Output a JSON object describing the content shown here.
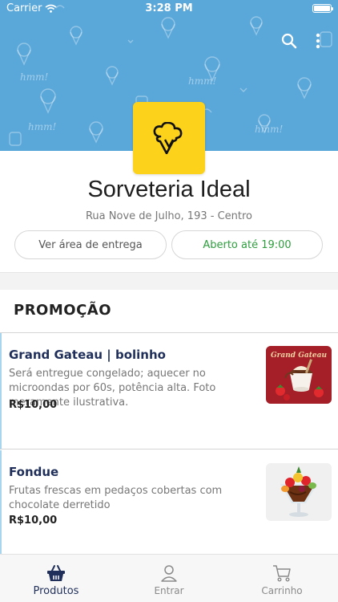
{
  "status_bar": {
    "carrier": "Carrier",
    "time": "3:28 PM"
  },
  "store": {
    "name": "Sorveteria Ideal",
    "address": "Rua Nove de Julho, 193 - Centro",
    "delivery_area_label": "Ver área de entrega",
    "hours_label": "Aberto até 19:00"
  },
  "colors": {
    "header_blue": "#5aa7d9",
    "logo_yellow": "#fcd21a",
    "open_green": "#2e9e3e",
    "product_title": "#1f2f5a"
  },
  "section": {
    "title": "PROMOÇÃO"
  },
  "products": [
    {
      "name": "Grand Gateau | bolinho",
      "description": "Será entregue congelado; aquecer no microondas por 60s, potência alta. Foto meramente ilustrativa.",
      "price": "R$10,00",
      "image_caption": "Grand Gateau"
    },
    {
      "name": "Fondue",
      "description": "Frutas frescas em pedaços cobertas com chocolate derretido",
      "price": "R$10,00"
    }
  ],
  "tabs": [
    {
      "label": "Produtos",
      "icon": "basket-icon",
      "active": true
    },
    {
      "label": "Entrar",
      "icon": "person-icon",
      "active": false
    },
    {
      "label": "Carrinho",
      "icon": "cart-icon",
      "active": false
    }
  ]
}
